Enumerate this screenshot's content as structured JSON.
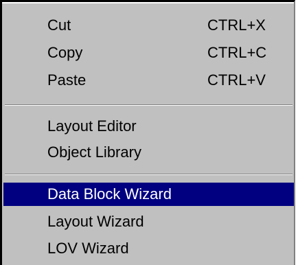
{
  "menu": {
    "items": [
      {
        "label": "Cut",
        "shortcut": "CTRL+X"
      },
      {
        "label": "Copy",
        "shortcut": "CTRL+C"
      },
      {
        "label": "Paste",
        "shortcut": "CTRL+V"
      },
      {
        "label": "Layout Editor",
        "shortcut": ""
      },
      {
        "label": "Object Library",
        "shortcut": ""
      },
      {
        "label": "Data Block Wizard",
        "shortcut": "",
        "highlighted": true
      },
      {
        "label": "Layout Wizard",
        "shortcut": ""
      },
      {
        "label": "LOV Wizard",
        "shortcut": ""
      }
    ]
  },
  "colors": {
    "menu_background": "#c0c0c0",
    "highlight_background": "#000080",
    "highlight_text": "#ffffff",
    "text": "#000000"
  }
}
